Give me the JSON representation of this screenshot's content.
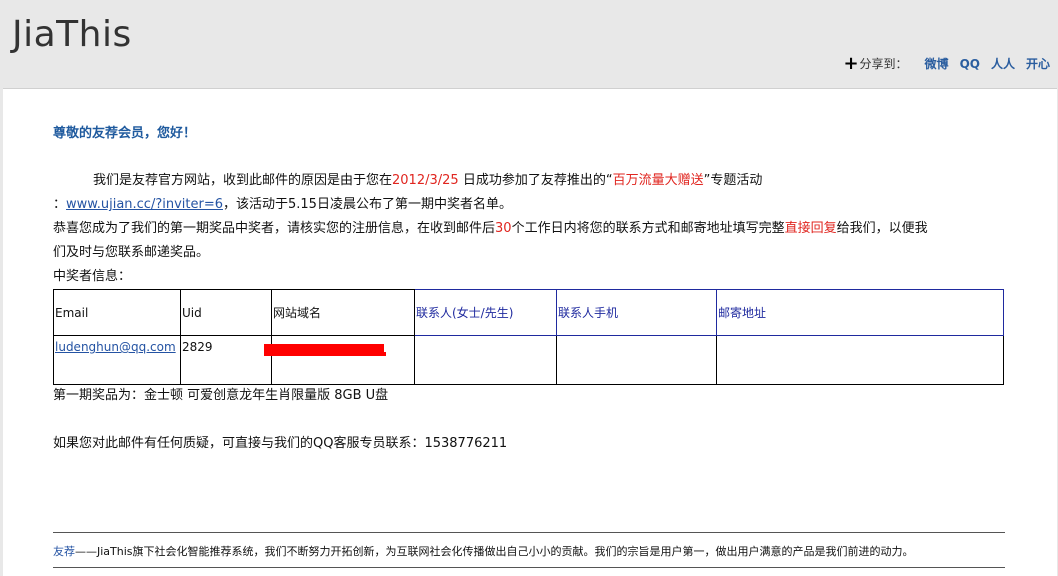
{
  "header": {
    "logo": "JiaThis",
    "share_label": "分享到：",
    "share_links": [
      "微博",
      "QQ",
      "人人",
      "开心"
    ]
  },
  "email": {
    "greeting": "尊敬的友荐会员，您好！",
    "p1_a": "我们是友荐官方网站，收到此邮件的原因是由于您在",
    "p1_date": "2012/3/25",
    "p1_b": " 日成功参加了友荐推出的“",
    "p1_campaign": "百万流量大赠送",
    "p1_c": "”专题活动",
    "p2_prefix": "：",
    "p2_link": "www.ujian.cc/?inviter=6",
    "p2_rest": "，该活动于5.15日凌晨公布了第一期中奖者名单。",
    "p3_a": "恭喜您成为了我们的第一期奖品中奖者，请核实您的注册信息，在收到邮件后",
    "p3_days": "30",
    "p3_b": "个工作日内将您的联系方式和邮寄地址填写完整",
    "p3_reply": "直接回复",
    "p3_c": "给我们，以便我",
    "p3_d": "们及时与您联系邮递奖品。",
    "winner_label": "中奖者信息：",
    "table": {
      "headers": [
        "Email",
        "Uid",
        "网站域名",
        "联系人(女士/先生)",
        "联系人手机",
        "邮寄地址"
      ],
      "row": [
        "ludenghun@qq.com",
        "2829",
        "",
        "",
        "",
        ""
      ]
    },
    "prize": "第一期奖品为：金士顿 可爱创意龙年生肖限量版 8GB U盘",
    "contact": "如果您对此邮件有任何质疑，可直接与我们的QQ客服专员联系：1538776211"
  },
  "footer": {
    "brand": "友荐",
    "text": "——JiaThis旗下社会化智能推荐系统，我们不断努力开拓创新，为互联网社会化传播做出自己小小的贡献。我们的宗旨是用户第一，做出用户满意的产品是我们前进的动力。"
  },
  "colors": {
    "link_blue": "#2453a3",
    "highlight_red": "#e0251f",
    "header_bg": "#e8e8e8"
  }
}
